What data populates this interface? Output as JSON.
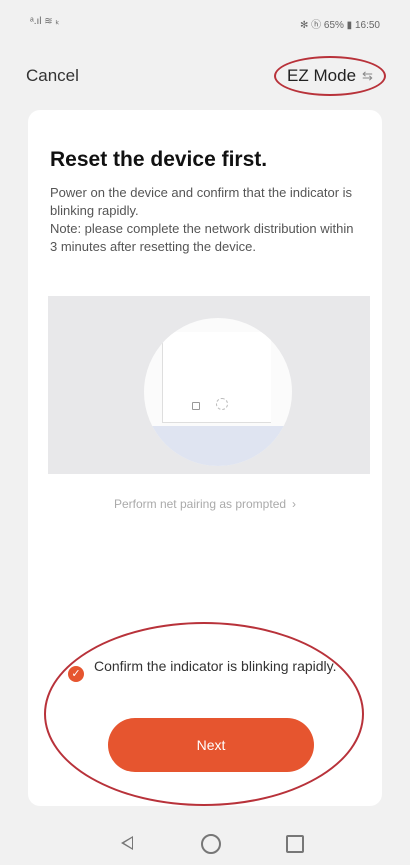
{
  "status_bar": {
    "left": "ᵃ.ıl ≋ ₖ",
    "right": "✻ ⓗ 65% ▮ 16:50"
  },
  "header": {
    "cancel_label": "Cancel",
    "mode_label": "EZ Mode",
    "mode_icon": "swap-arrows-icon"
  },
  "content": {
    "title": "Reset the device first.",
    "description": "Power on the device and confirm that the indicator is blinking rapidly.\nNote: please complete the network distribution within 3 minutes after resetting the device.",
    "pairing_link": "Perform net pairing as prompted",
    "confirm_label": "Confirm the indicator is blinking rapidly.",
    "confirm_checked": true,
    "next_label": "Next"
  },
  "colors": {
    "accent": "#e6552f",
    "annotation_circle": "#b8323a"
  }
}
